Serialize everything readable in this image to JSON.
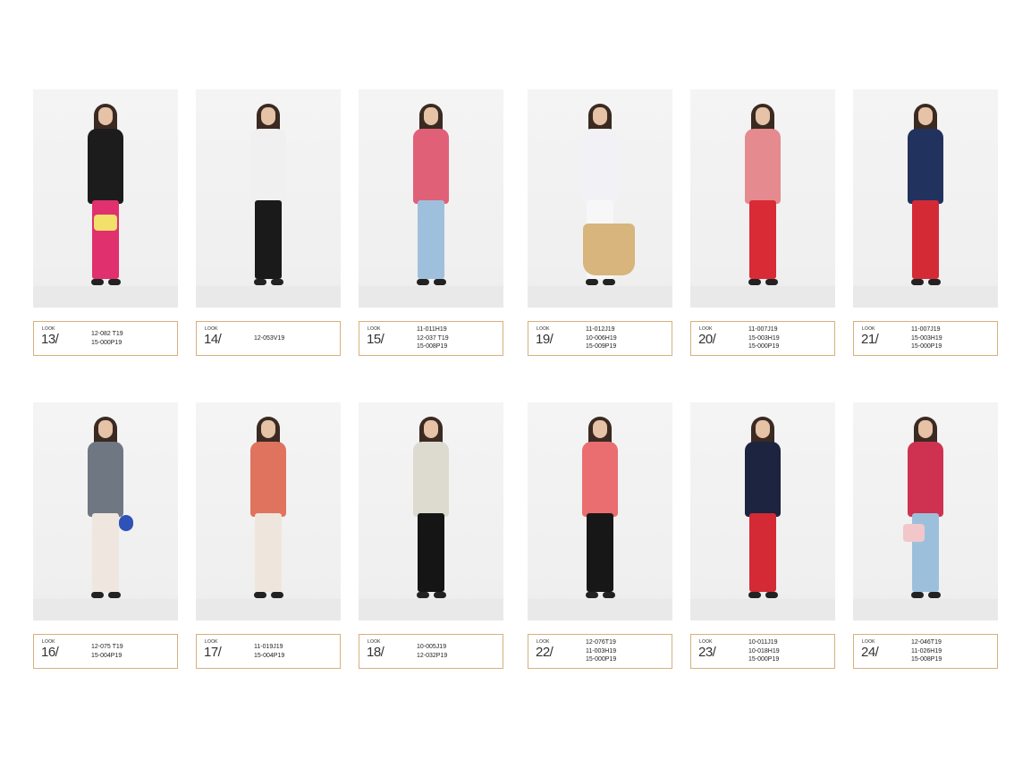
{
  "look_word": "LOOK",
  "colors": {
    "label_border": "#d6b07c"
  },
  "looks": [
    {
      "number": "13/",
      "codes": [
        "12-082 T19",
        "15-000P19"
      ],
      "top_color": "#1c1c1c",
      "bottom_color": "#e0306e",
      "bag": "yellow"
    },
    {
      "number": "14/",
      "codes": [
        "12-053V19"
      ],
      "top_color": "#f0f0f0",
      "bottom_color": "#1a1a1a",
      "bag": "black"
    },
    {
      "number": "15/",
      "codes": [
        "11-011H19",
        "12-037 T19",
        "15-008P19"
      ],
      "top_color": "#e06078",
      "bottom_color": "#9fc0dc",
      "bag": ""
    },
    {
      "number": "19/",
      "codes": [
        "11-012J19",
        "10-006H19",
        "15-009P19"
      ],
      "top_color": "#f2f2f6",
      "bottom_color": "#f7f7f7",
      "bag": "straw"
    },
    {
      "number": "20/",
      "codes": [
        "11-007J19",
        "15-003H19",
        "15-000P19"
      ],
      "top_color": "#e58a8e",
      "bottom_color": "#d92b36",
      "bag": ""
    },
    {
      "number": "21/",
      "codes": [
        "11-007J19",
        "15-003H19",
        "15-000P19"
      ],
      "top_color": "#22325e",
      "bottom_color": "#d42a36",
      "bag": ""
    },
    {
      "number": "16/",
      "codes": [
        "12-075 T19",
        "15-004P19"
      ],
      "top_color": "#6f7782",
      "bottom_color": "#efe7df",
      "bag": "blue"
    },
    {
      "number": "17/",
      "codes": [
        "11-019J19",
        "15-004P19"
      ],
      "top_color": "#e0735e",
      "bottom_color": "#eee6dc",
      "bag": ""
    },
    {
      "number": "18/",
      "codes": [
        "10-005J19",
        "12-032P19"
      ],
      "top_color": "#dddad0",
      "bottom_color": "#151515",
      "bag": ""
    },
    {
      "number": "22/",
      "codes": [
        "12-076T19",
        "11-003H19",
        "15-000P19"
      ],
      "top_color": "#ea6d70",
      "bottom_color": "#171717",
      "bag": ""
    },
    {
      "number": "23/",
      "codes": [
        "10-011J19",
        "10-018H19",
        "15-000P19"
      ],
      "top_color": "#1d2440",
      "bottom_color": "#d42a36",
      "bag": ""
    },
    {
      "number": "24/",
      "codes": [
        "12-046T19",
        "11-026H19",
        "15-008P19"
      ],
      "top_color": "#cf3250",
      "bottom_color": "#9cc0dc",
      "bag": "pink"
    }
  ]
}
